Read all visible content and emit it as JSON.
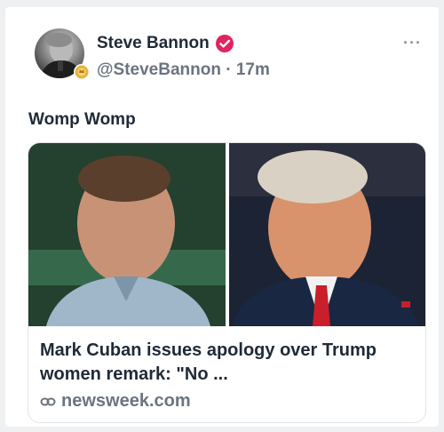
{
  "author": {
    "display_name": "Steve Bannon",
    "handle": "@SteveBannon",
    "separator": "·",
    "time_ago": "17m"
  },
  "menu": {
    "more_label": "···"
  },
  "post": {
    "text": "Womp Womp"
  },
  "link_card": {
    "title": "Mark Cuban issues apology over Trump women remark: \"No ...",
    "domain": "newsweek.com"
  },
  "colors": {
    "verified": "#e0245e",
    "text_primary": "#1f2a37",
    "text_secondary": "#6b7480",
    "badge_gold": "#e6b23a"
  },
  "icons": {
    "verified": "verified-check-icon",
    "badge": "affiliate-badge-icon",
    "link": "link-icon",
    "more": "more-options-icon"
  }
}
